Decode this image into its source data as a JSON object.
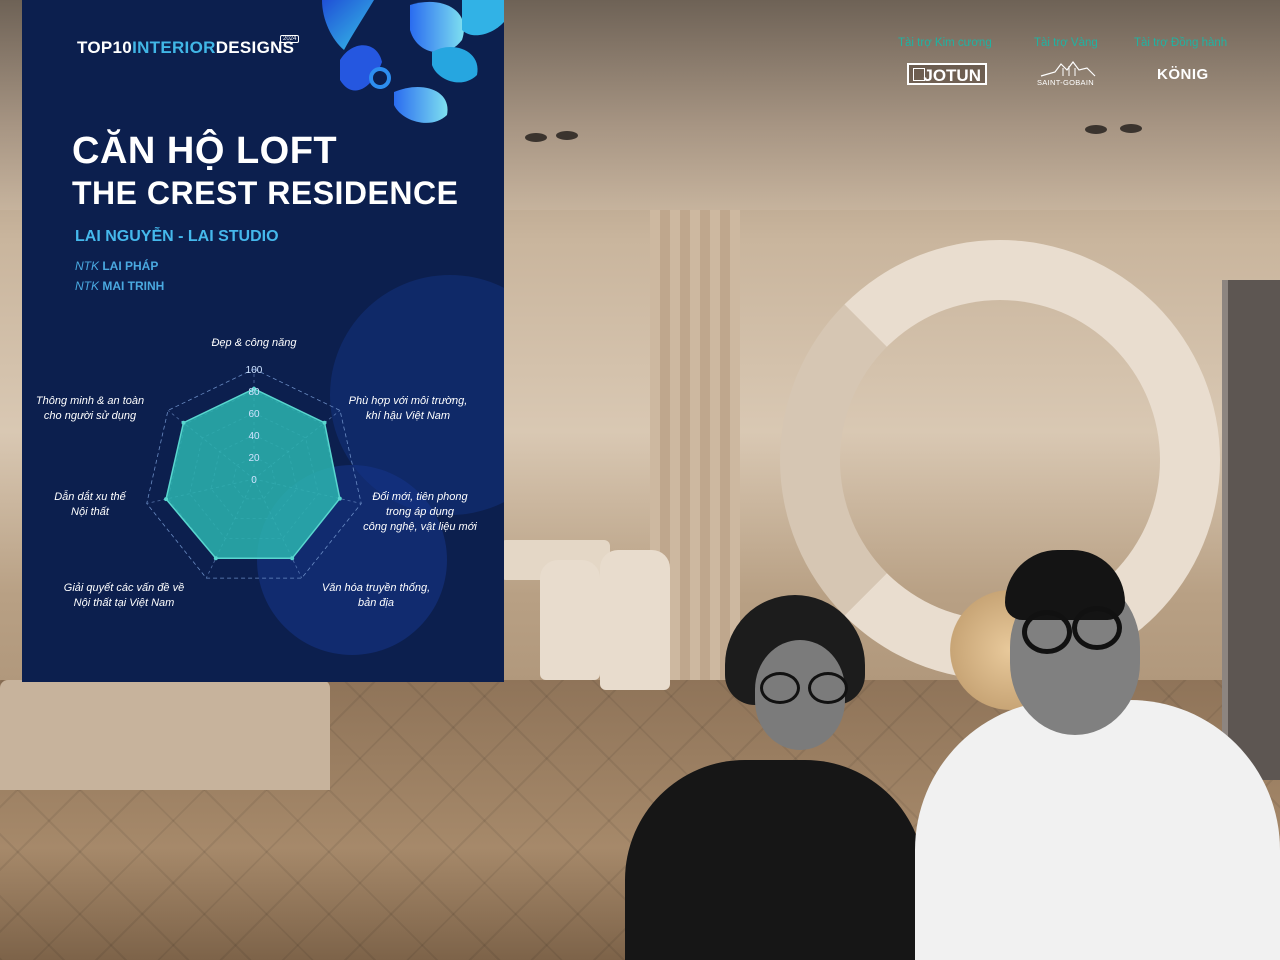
{
  "poster": {
    "brand_top": "TOP10",
    "brand_interior": "INTERIOR",
    "brand_designs": "DESIGNS",
    "brand_year": "2024",
    "title_line1": "CĂN HỘ LOFT",
    "title_line2": "THE CREST RESIDENCE",
    "studio": "LAI NGUYỄN - LAI STUDIO",
    "designers": [
      {
        "prefix": "NTK",
        "name": "LAI PHÁP"
      },
      {
        "prefix": "NTK",
        "name": "MAI TRINH"
      }
    ],
    "colors": {
      "background": "#0c1f4e",
      "accent": "#45b8ec",
      "radar_fill": "#2bb5b0"
    }
  },
  "sponsors": [
    {
      "label": "Tài trợ Kim cương",
      "logo": "JOTUN"
    },
    {
      "label": "Tài trợ Vàng",
      "logo": "SAINT-GOBAIN"
    },
    {
      "label": "Tài trợ Đồng hành",
      "logo": "KÖNIG"
    }
  ],
  "chart_data": {
    "type": "radar",
    "title": "",
    "axes": [
      [
        "Đẹp & công năng"
      ],
      [
        "Phù hợp với môi trường,",
        "khí hậu Việt Nam"
      ],
      [
        "Đổi mới, tiên phong",
        "trong áp dụng",
        "công nghệ, vật liệu mới"
      ],
      [
        "Văn hóa truyền thống,",
        "bản địa"
      ],
      [
        "Giải quyết các vấn đề về",
        "Nội thất tại Việt Nam"
      ],
      [
        "Dẫn dắt xu thế",
        "Nội thất"
      ],
      [
        "Thông minh & an toàn",
        "cho người sử dụng"
      ]
    ],
    "values": [
      82,
      82,
      80,
      80,
      80,
      82,
      82
    ],
    "rlim": [
      0,
      100
    ],
    "ticks": [
      "0",
      "20",
      "40",
      "60",
      "80",
      "100"
    ],
    "grid": true,
    "legend": "none"
  }
}
